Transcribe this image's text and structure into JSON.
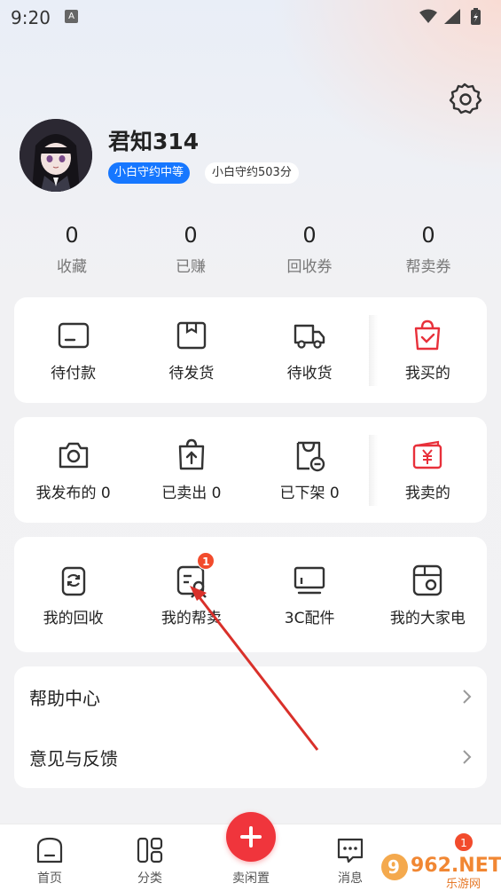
{
  "status_bar": {
    "time": "9:20",
    "indicator": "A"
  },
  "profile": {
    "username": "君知314",
    "badge_level": "小白守约中等",
    "badge_score": "小白守约503分"
  },
  "stats": [
    {
      "value": "0",
      "label": "收藏"
    },
    {
      "value": "0",
      "label": "已赚"
    },
    {
      "value": "0",
      "label": "回收券"
    },
    {
      "value": "0",
      "label": "帮卖券"
    }
  ],
  "buy_section": {
    "items": [
      {
        "label": "待付款",
        "icon": "wallet-icon"
      },
      {
        "label": "待发货",
        "icon": "package-icon"
      },
      {
        "label": "待收货",
        "icon": "truck-icon"
      },
      {
        "label": "我买的",
        "icon": "shopping-bag-icon"
      }
    ]
  },
  "sell_section": {
    "items": [
      {
        "label": "我发布的 0",
        "icon": "camera-icon"
      },
      {
        "label": "已卖出 0",
        "icon": "upload-bag-icon"
      },
      {
        "label": "已下架 0",
        "icon": "removed-bag-icon"
      },
      {
        "label": "我卖的",
        "icon": "yuan-wallet-icon"
      }
    ]
  },
  "service_section": {
    "items": [
      {
        "label": "我的回收",
        "icon": "recycle-icon"
      },
      {
        "label": "我的帮卖",
        "icon": "help-sell-icon",
        "badge": "1"
      },
      {
        "label": "3C配件",
        "icon": "monitor-icon"
      },
      {
        "label": "我的大家电",
        "icon": "appliance-icon"
      }
    ]
  },
  "list": {
    "items": [
      {
        "label": "帮助中心"
      },
      {
        "label": "意见与反馈"
      }
    ]
  },
  "tabbar": {
    "items": [
      {
        "label": "首页",
        "icon": "home-icon"
      },
      {
        "label": "分类",
        "icon": "category-icon"
      },
      {
        "label": "卖闲置",
        "icon": "plus-icon"
      },
      {
        "label": "消息",
        "icon": "message-icon"
      }
    ],
    "message_badge": "1"
  },
  "watermark": {
    "text": "962.NET",
    "subtext": "乐游网"
  },
  "colors": {
    "accent_red": "#f0353c",
    "badge_blue": "#1677ff",
    "badge_red": "#f24b2c",
    "annotation_arrow": "#d9302a"
  }
}
